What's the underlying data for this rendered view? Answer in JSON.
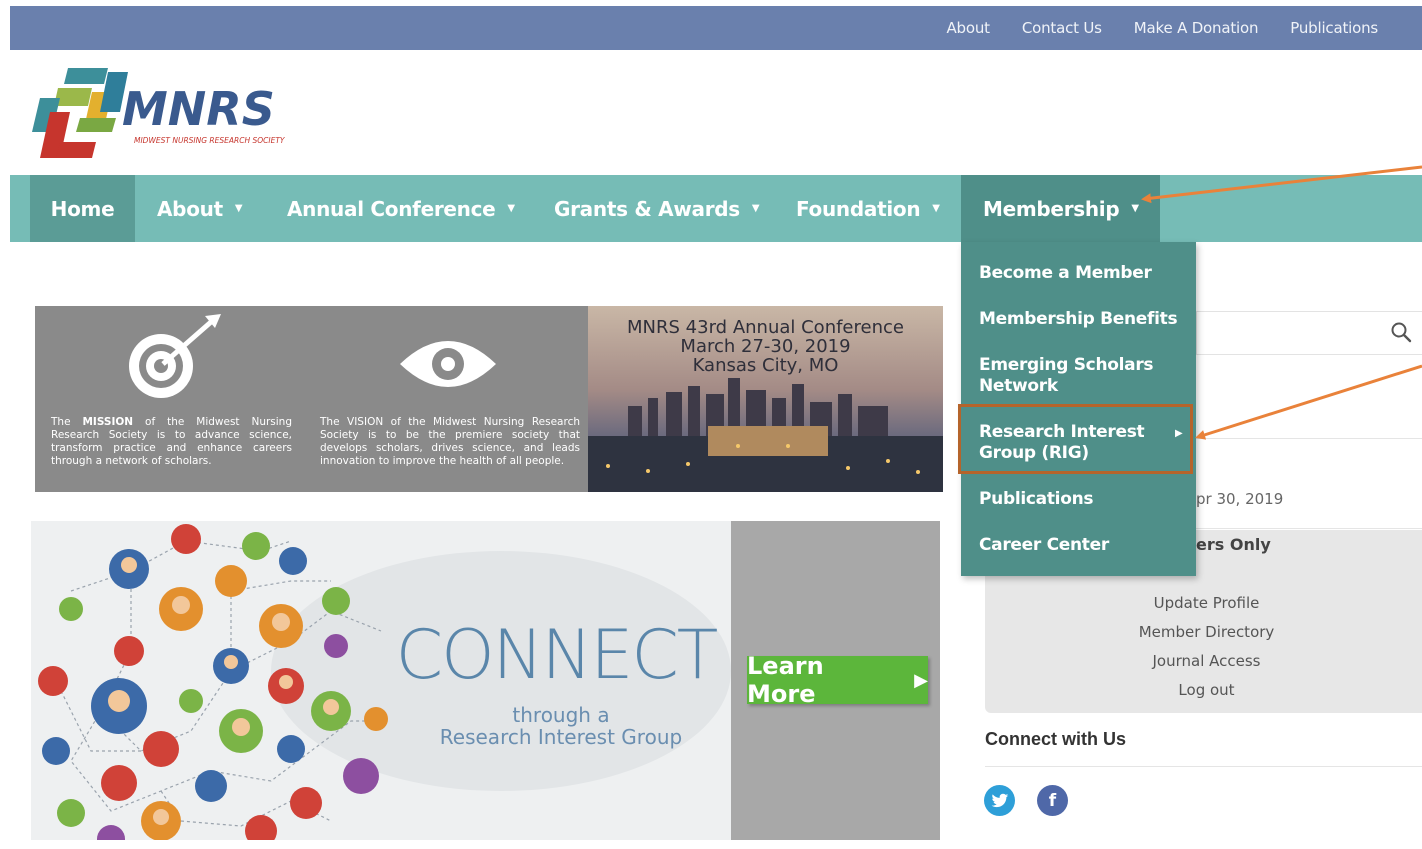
{
  "top_links": [
    "About",
    "Contact Us",
    "Make A Donation",
    "Publications"
  ],
  "logo": {
    "name": "MNRS",
    "tagline": "MIDWEST NURSING RESEARCH SOCIETY"
  },
  "nav": {
    "home": "Home",
    "items": [
      "About",
      "Annual Conference",
      "Grants & Awards",
      "Foundation"
    ],
    "membership": "Membership"
  },
  "membership_menu": [
    "Become a Member",
    "Membership Benefits",
    "Emerging Scholars Network",
    "Research Interest Group (RIG)",
    "Publications",
    "Career Center"
  ],
  "banner1": {
    "mission_prefix": "The ",
    "mission_bold": "MISSION",
    "mission_rest": " of the Midwest Nursing Research Society is to advance science, transform practice and enhance careers through a network of scholars.",
    "vision": "The VISION of the Midwest Nursing Research Society is to be the premiere society that develops scholars, drives science, and leads innovation to improve the health of all people.",
    "conf_line1": "MNRS 43rd Annual Conference",
    "conf_line2": "March 27-30, 2019",
    "conf_line3": "Kansas City, MO"
  },
  "banner2": {
    "headline": "CONNECT",
    "sub1": "through a",
    "sub2": "Research Interest Group",
    "button": "Learn More"
  },
  "sidebar": {
    "date_fragment": "pr 30, 2019",
    "members_title": "ers Only",
    "member_links": [
      "Update Profile",
      "Member Directory",
      "Journal Access",
      "Log out"
    ],
    "connect_title": "Connect with Us"
  },
  "colors": {
    "topbar": "#6a80ad",
    "nav": "#76bcb6",
    "nav_active": "#4f8f89",
    "annotation": "#e9823a",
    "highlight_box": "#b5642b",
    "learn_more": "#5cb63b"
  }
}
